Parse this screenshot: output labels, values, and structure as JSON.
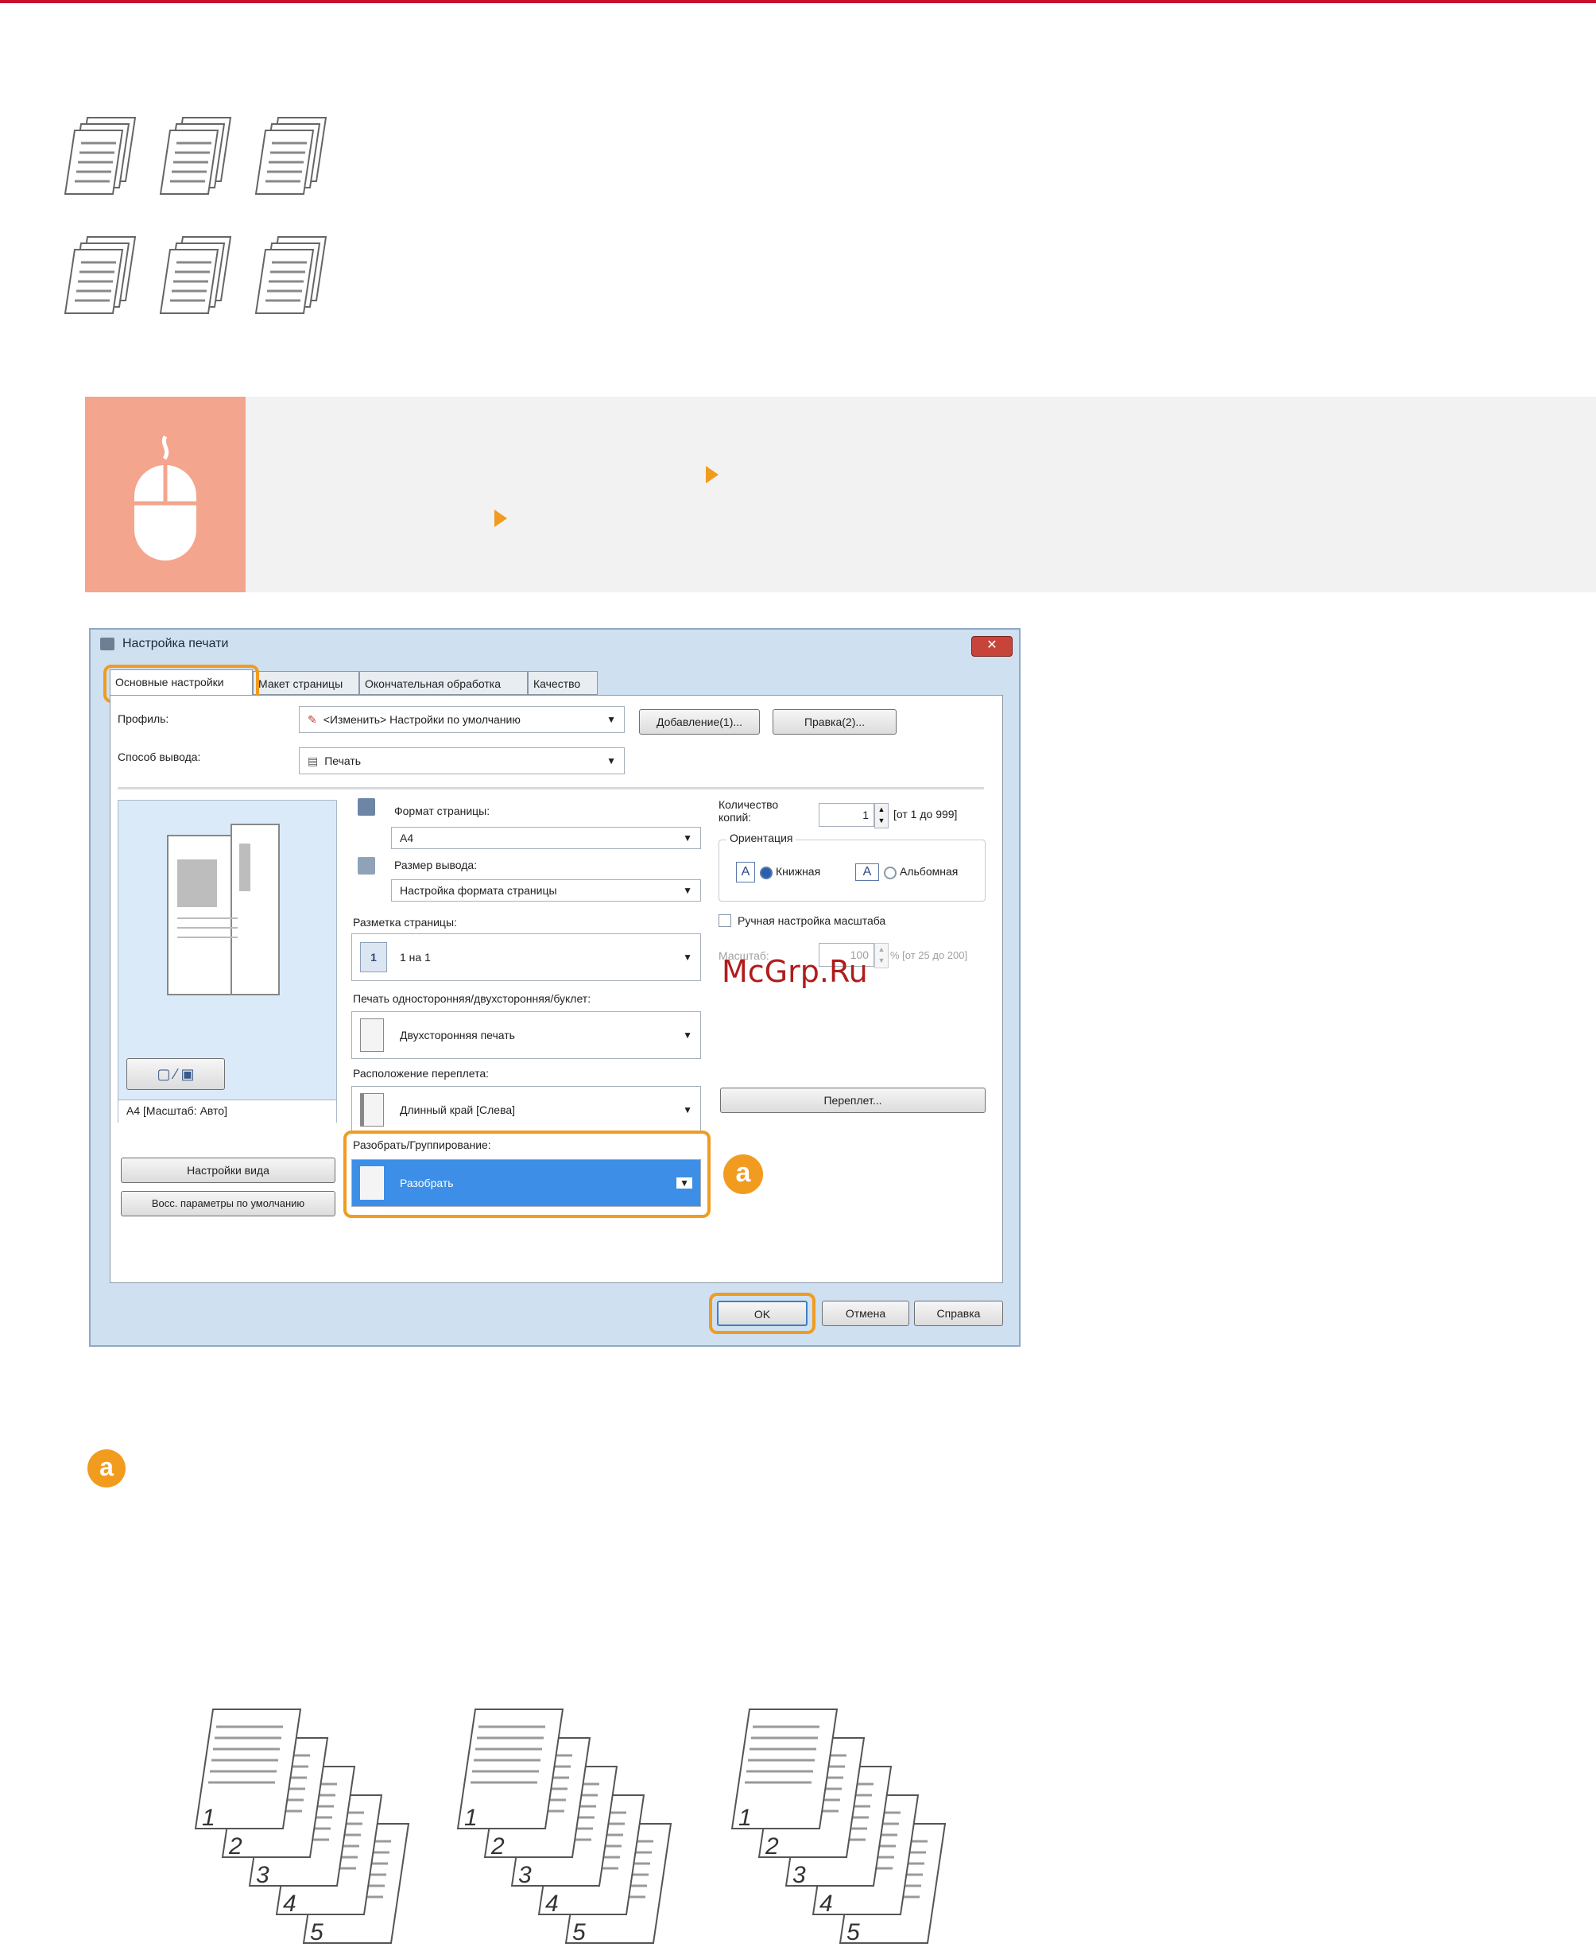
{
  "dialog": {
    "title": "Настройка печати",
    "close_glyph": "✕",
    "tabs": [
      {
        "label": "Основные настройки"
      },
      {
        "label": "Макет страницы"
      },
      {
        "label": "Окончательная обработка"
      },
      {
        "label": "Качество"
      }
    ],
    "profile": {
      "label": "Профиль:",
      "value": "<Изменить> Настройки по умолчанию",
      "add_button": "Добавление(1)...",
      "edit_button": "Правка(2)..."
    },
    "output_method": {
      "label": "Способ вывода:",
      "value": "Печать"
    },
    "page_size": {
      "label": "Формат страницы:",
      "value": "A4"
    },
    "output_size": {
      "label": "Размер вывода:",
      "value": "Настройка формата страницы"
    },
    "copies": {
      "label": "Количество копий:",
      "value": "1",
      "range": "[от 1 до 999]"
    },
    "orientation": {
      "label": "Ориентация",
      "portrait": "Книжная",
      "landscape": "Альбомная"
    },
    "manual_scaling": {
      "label": "Ручная настройка масштаба",
      "scale_label": "Масштаб:",
      "scale_value": "100",
      "scale_range": "% [от 25 до 200]"
    },
    "page_layout": {
      "label": "Разметка страницы:",
      "value": "1 на 1",
      "badge": "1"
    },
    "duplex": {
      "label": "Печать односторонняя/двухсторонняя/буклет:",
      "value": "Двухсторонняя печать"
    },
    "binding": {
      "label": "Расположение переплета:",
      "value": "Длинный край [Слева]",
      "button": "Переплет..."
    },
    "collate": {
      "label": "Разобрать/Группирование:",
      "value": "Разобрать"
    },
    "preview_caption": "A4 [Масштаб: Авто]",
    "view_settings_button": "Настройки вида",
    "restore_defaults_button": "Восс. параметры по умолчанию",
    "ok_button": "OK",
    "cancel_button": "Отмена",
    "help_button": "Справка"
  },
  "callout": {
    "letter": "a"
  },
  "watermark": "McGrp.Ru",
  "stack_numbers": [
    "1",
    "2",
    "3",
    "4",
    "5"
  ],
  "colors": {
    "accent": "#f19b1f",
    "top_line": "#c8102e",
    "tip_icon_bg": "#f4a58e",
    "selection": "#3c8ee6"
  }
}
